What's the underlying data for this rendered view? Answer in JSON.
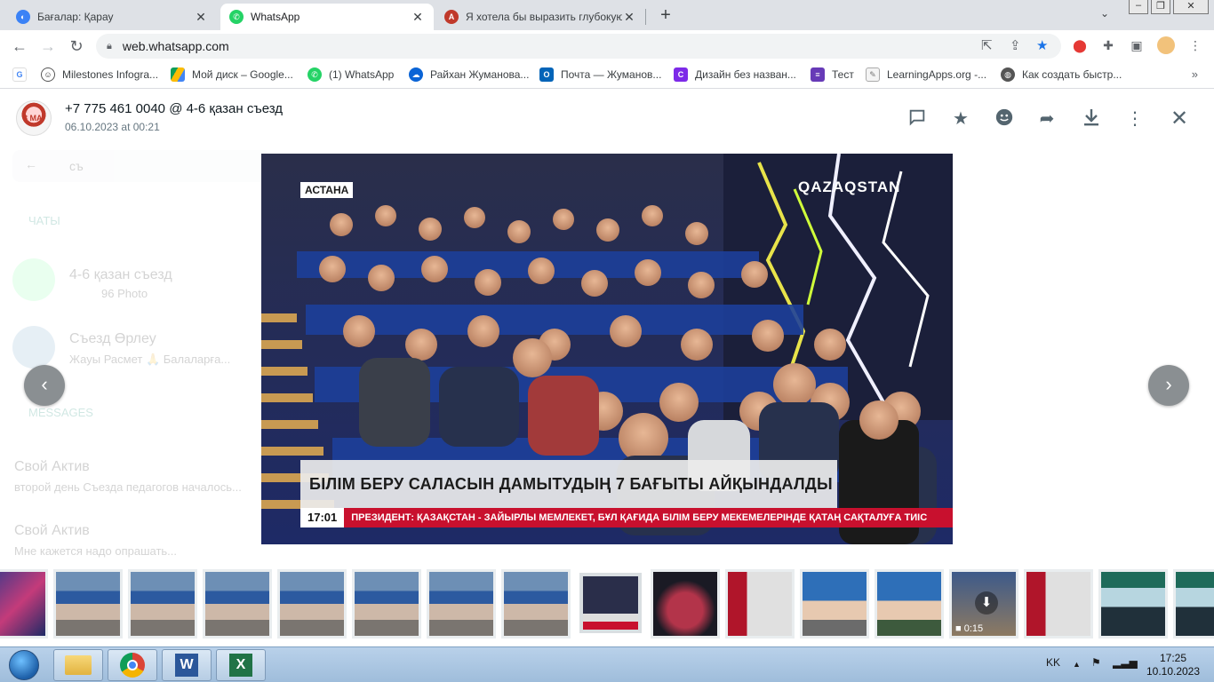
{
  "browser": {
    "tabs": [
      {
        "title": "Бағалар: Қарау",
        "active": false
      },
      {
        "title": "WhatsApp",
        "active": true
      },
      {
        "title": "Я хотела бы выразить глубокую",
        "active": false
      }
    ],
    "url": "web.whatsapp.com",
    "bookmarks": [
      "Milestones Infogra...",
      "Мой диск – Google...",
      "(1) WhatsApp",
      "Райхан Жуманова...",
      "Почта — Жуманов...",
      "Дизайн без назван...",
      "Тест",
      "LearningApps.org -...",
      "Как создать быстр..."
    ]
  },
  "viewer": {
    "sender": "+7 775 461 0040 @ 4-6 қазан съезд",
    "date": "06.10.2023 at 00:21",
    "icons": [
      "message-icon",
      "star-icon",
      "emoji-icon",
      "forward-icon",
      "download-icon",
      "menu-icon",
      "close-icon"
    ]
  },
  "background_chat": {
    "search": "съ",
    "chats_header": "ЧАТЫ",
    "chats": [
      {
        "name": "4-6 қазан съезд",
        "preview": "96 Photo"
      },
      {
        "name": "Съезд Өрлеу",
        "preview": "Жауы Расмет 🙏 Балаларға..."
      }
    ],
    "messages_header": "MESSAGES",
    "messages": [
      {
        "name": "Свой Актив",
        "preview": "второй день Съезда педагогов началось..."
      },
      {
        "name": "Свой Актив",
        "preview": "Мне кажется надо опрашать..."
      }
    ]
  },
  "media": {
    "city_tag": "АСТАНА",
    "channel": "QAZAQSTAN",
    "headline": "БІЛІМ БЕРУ САЛАСЫН ДАМЫТУДЫҢ 7 БАҒЫТЫ АЙҚЫНДАЛДЫ",
    "time": "17:01",
    "ticker": "ПРЕЗИДЕНТ: ҚАЗАҚСТАН - ЗАЙЫРЛЫ МЕМЛЕКЕТ, БҰЛ ҚАҒИДА БІЛІМ БЕРУ МЕКЕМЕЛЕРІНДЕ ҚАТАҢ САҚТАЛУҒА ТИІС"
  },
  "thumbnails": [
    {
      "kind": "tv"
    },
    {
      "kind": "group"
    },
    {
      "kind": "group"
    },
    {
      "kind": "group"
    },
    {
      "kind": "group"
    },
    {
      "kind": "group"
    },
    {
      "kind": "group"
    },
    {
      "kind": "group"
    },
    {
      "kind": "current"
    },
    {
      "kind": "hall"
    },
    {
      "kind": "statue"
    },
    {
      "kind": "ladies"
    },
    {
      "kind": "ladies2"
    },
    {
      "kind": "video",
      "duration": "0:15"
    },
    {
      "kind": "statue"
    },
    {
      "kind": "restaurant"
    },
    {
      "kind": "restaurant"
    }
  ],
  "taskbar": {
    "lang": "KK",
    "time": "17:25",
    "date": "10.10.2023"
  }
}
